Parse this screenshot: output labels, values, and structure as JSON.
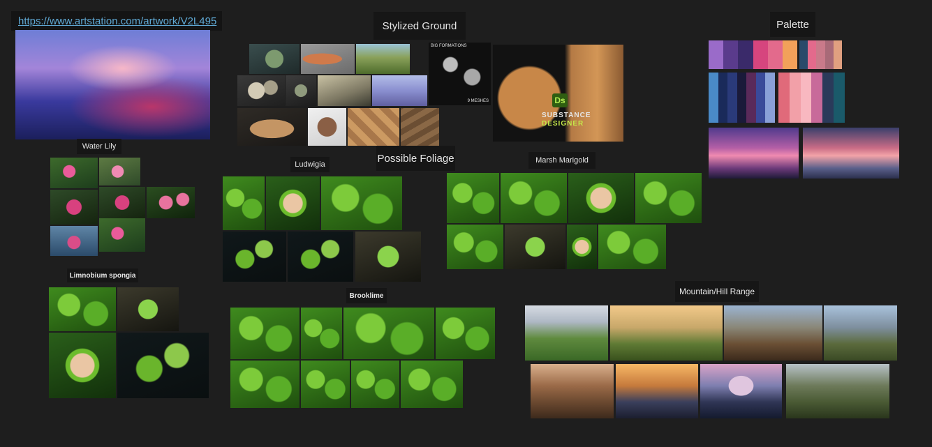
{
  "board": {
    "link": "https://www.artstation.com/artwork/V2L495",
    "section_titles": {
      "stylized_ground": "Stylized Ground",
      "palette": "Palette",
      "possible_foliage": "Possible Foliage",
      "water_lily": "Water Lily",
      "ludwigia": "Ludwigia",
      "marsh_marigold": "Marsh Marigold",
      "limnobium": "Limnobium spongia",
      "brooklime": "Brooklime",
      "mountain": "Mountain/Hill Range"
    },
    "substance": {
      "badge": "Ds",
      "line1": "SUBSTANCE",
      "line2": "DESIGNER"
    },
    "big_formations": {
      "title": "BIG FORMATIONS",
      "count": "9 MESHES"
    }
  },
  "palette": {
    "strip1": [
      "#9a6bc9",
      "#5a3b8c",
      "#3a2a6a",
      "#d6457e",
      "#e36a8c",
      "#f2a15a"
    ],
    "strip2": [
      "#2a4a6a",
      "#e36a8c",
      "#c97a8a",
      "#a86a78",
      "#e0a080"
    ],
    "strip3": [
      "#4a8ac8",
      "#1a2a5a",
      "#2a3a7a",
      "#1a1a3a",
      "#5a2a5a",
      "#3a4a9a",
      "#8aa0d8"
    ],
    "strip4": [
      "#e06a7a",
      "#f2a0a8",
      "#f8b8c0",
      "#c86a9a",
      "#2a3a5a",
      "#1a5a6a"
    ]
  }
}
